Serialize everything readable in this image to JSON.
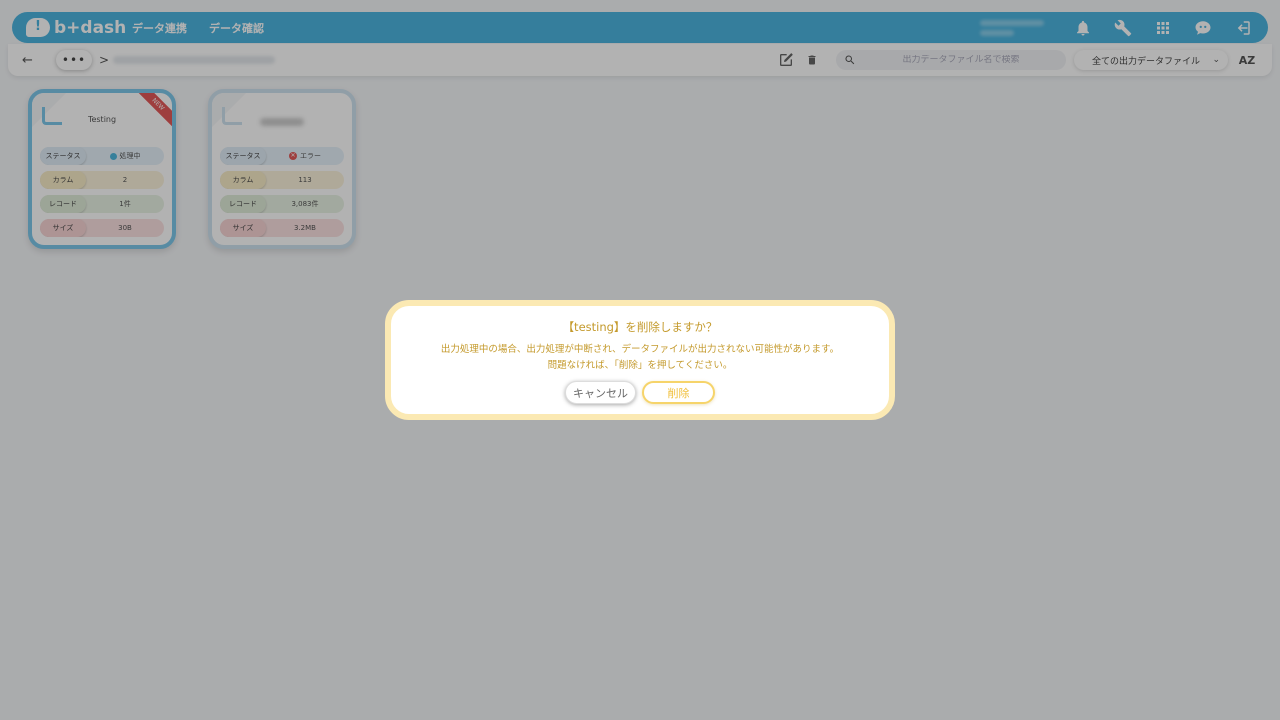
{
  "header": {
    "logo_text": "b+dash",
    "nav": [
      "データ連携",
      "データ確認"
    ],
    "icons": [
      "bell-icon",
      "wrench-icon",
      "apps-grid-icon",
      "chat-bot-icon",
      "logout-icon"
    ]
  },
  "toolbar": {
    "back_label": "←",
    "more_label": "•••",
    "breadcrumb_separator": ">",
    "search_placeholder": "出力データファイル名で検索",
    "filter_selected": "全ての出力データファイル",
    "sort_label": "AZ"
  },
  "cards": [
    {
      "title": "Testing",
      "badge": "NEW",
      "rows": {
        "status_label": "ステータス",
        "status_value": "処理中",
        "column_label": "カラム",
        "column_value": "2",
        "record_label": "レコード",
        "record_value": "1件",
        "size_label": "サイズ",
        "size_value": "30B"
      }
    },
    {
      "title": "",
      "rows": {
        "status_label": "ステータス",
        "status_value": "エラー",
        "column_label": "カラム",
        "column_value": "113",
        "record_label": "レコード",
        "record_value": "3,083件",
        "size_label": "サイズ",
        "size_value": "3.2MB"
      }
    }
  ],
  "dialog": {
    "title": "【testing】を削除しますか？",
    "message_line1": "出力処理中の場合、出力処理が中断され、データファイルが出力されない可能性があります。",
    "message_line2": "問題なければ、「削除」を押してください。",
    "cancel_label": "キャンセル",
    "delete_label": "削除"
  },
  "colors": {
    "brand": "#4cb5e0",
    "dialog_text": "#c49a2c",
    "delete_accent": "#f0bf3a",
    "error": "#e35a5a"
  }
}
